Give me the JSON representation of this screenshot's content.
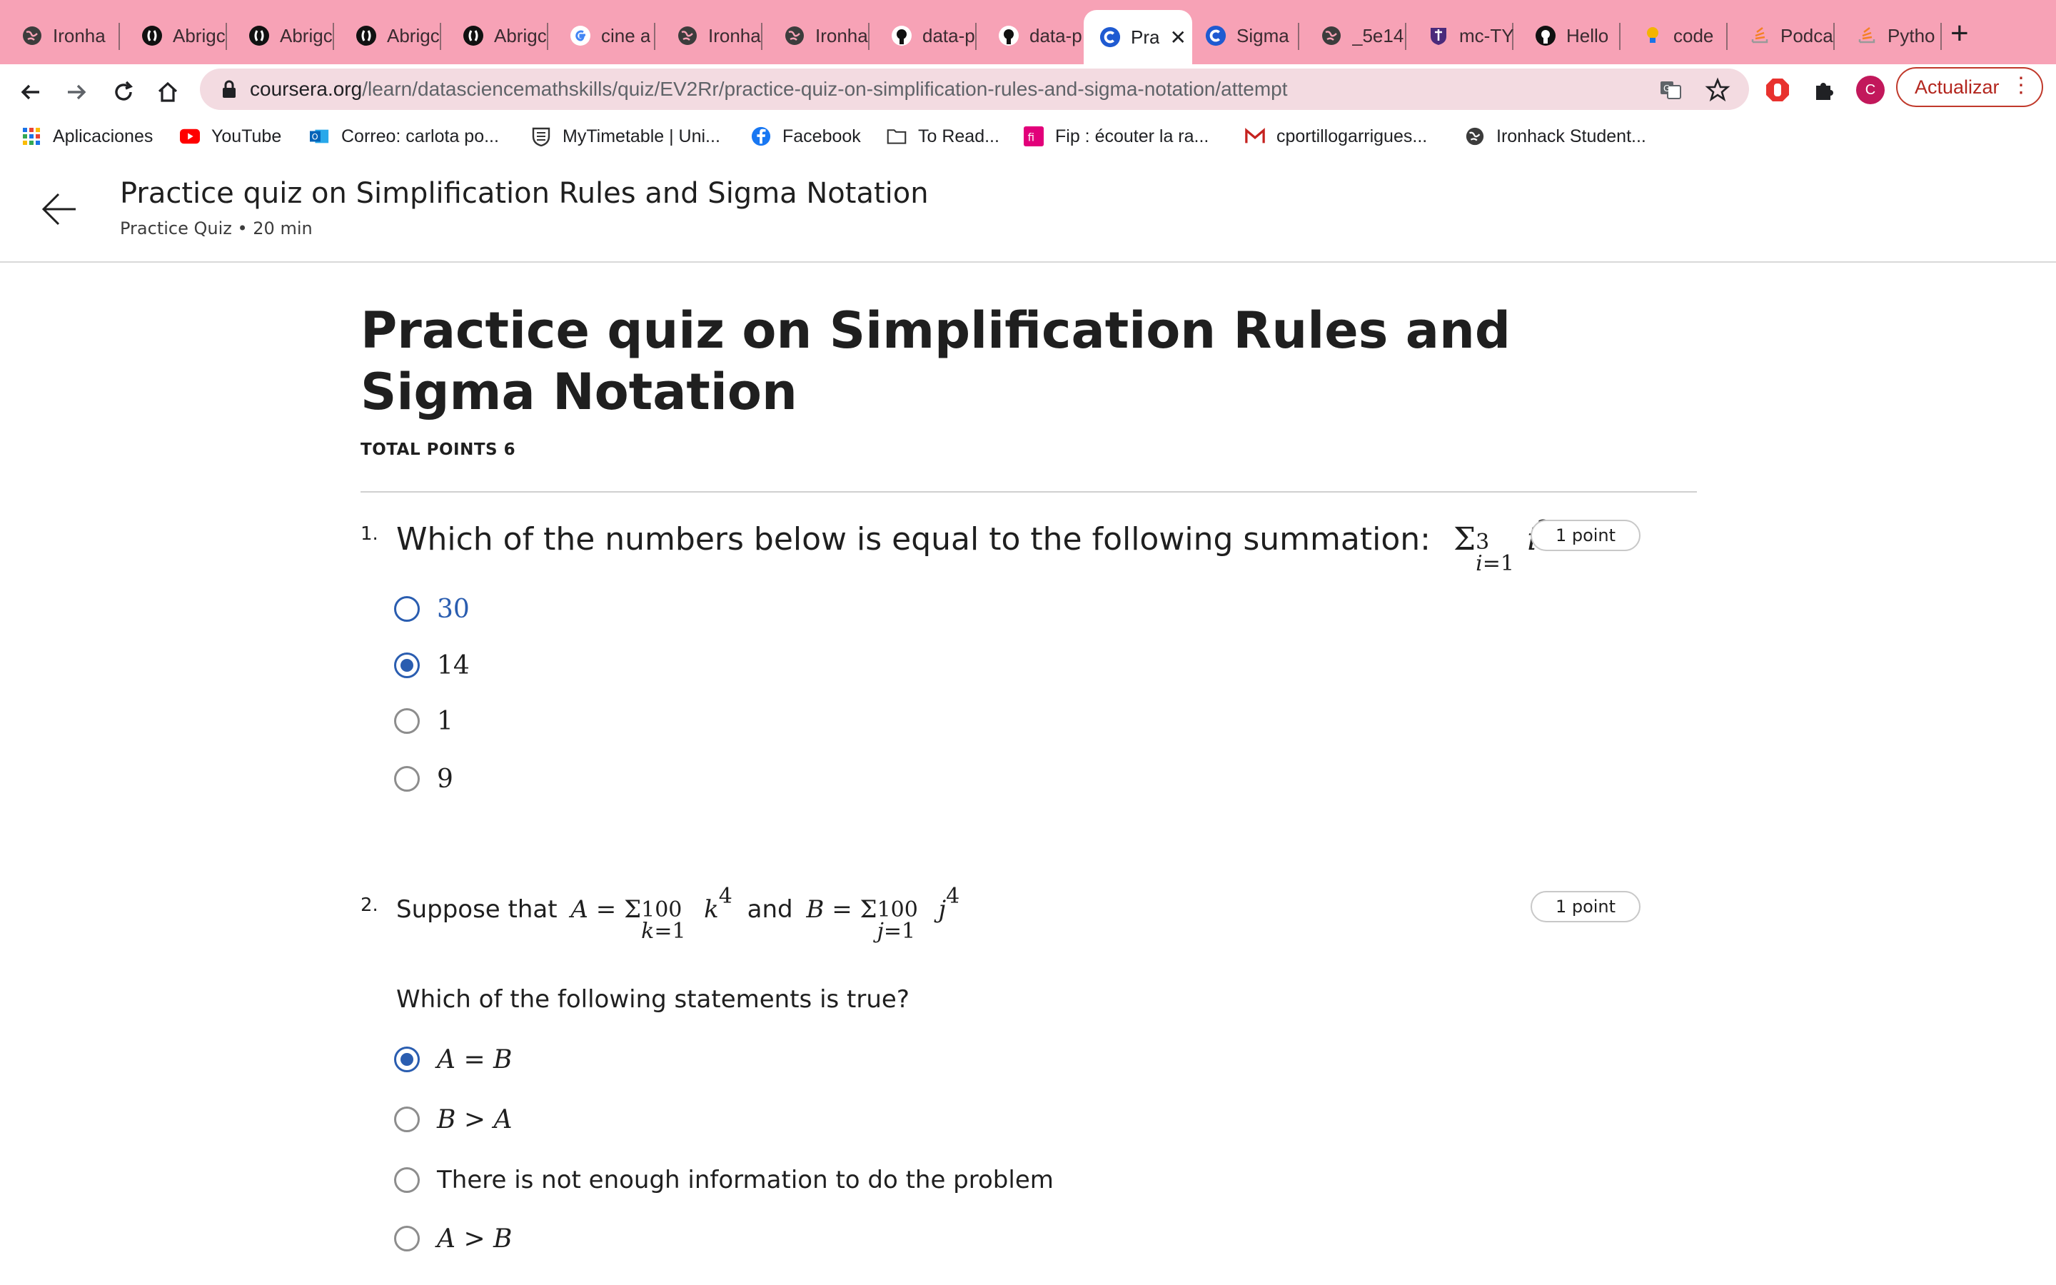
{
  "browser": {
    "tabs": [
      {
        "label": "Ironha",
        "icon": "globe-icon"
      },
      {
        "label": "Abrigc",
        "icon": "codepen-icon"
      },
      {
        "label": "Abrigc",
        "icon": "codepen-icon"
      },
      {
        "label": "Abrigc",
        "icon": "codepen-icon"
      },
      {
        "label": "Abrigc",
        "icon": "codepen-icon"
      },
      {
        "label": "cine a",
        "icon": "google-icon"
      },
      {
        "label": "Ironha",
        "icon": "globe-icon"
      },
      {
        "label": "Ironha",
        "icon": "globe-icon"
      },
      {
        "label": "data-p",
        "icon": "github-icon"
      },
      {
        "label": "data-p",
        "icon": "github-icon"
      },
      {
        "label": "Pra",
        "icon": "coursera-icon",
        "active": true
      },
      {
        "label": "Sigma",
        "icon": "coursera-icon"
      },
      {
        "label": "_5e14",
        "icon": "globe-icon"
      },
      {
        "label": "mc-TY",
        "icon": "shield-crest-icon"
      },
      {
        "label": "Hello",
        "icon": "github-icon"
      },
      {
        "label": "code",
        "icon": "lightbulb-icon"
      },
      {
        "label": "Podca",
        "icon": "stack-icon"
      },
      {
        "label": "Pytho",
        "icon": "stack-icon"
      }
    ],
    "url_host": "coursera.org",
    "url_path": "/learn/datasciencemathskills/quiz/EV2Rr/practice-quiz-on-simplification-rules-and-sigma-notation/attempt",
    "update_label": "Actualizar",
    "profile_letter": "C",
    "accent": "#f7a2b6",
    "bookmarks": [
      {
        "label": "Aplicaciones",
        "icon": "apps-grid-icon"
      },
      {
        "label": "YouTube",
        "icon": "youtube-icon"
      },
      {
        "label": "Correo: carlota po...",
        "icon": "outlook-icon"
      },
      {
        "label": "MyTimetable | Uni...",
        "icon": "crest-icon"
      },
      {
        "label": "Facebook",
        "icon": "facebook-icon"
      },
      {
        "label": "To Read...",
        "icon": "folder-icon"
      },
      {
        "label": "Fip : écouter la ra...",
        "icon": "fip-icon"
      },
      {
        "label": "cportillogarrigues...",
        "icon": "gmail-icon"
      },
      {
        "label": "Ironhack Student...",
        "icon": "globe-icon"
      }
    ]
  },
  "header": {
    "title": "Practice quiz on Simplification Rules and Sigma Notation",
    "subtitle": "Practice Quiz • 20 min"
  },
  "quiz": {
    "title": "Practice quiz on Simplification Rules and Sigma Notation",
    "total_points": "TOTAL POINTS 6",
    "questions": [
      {
        "number": "1.",
        "text": "Which of the numbers below is equal to the following summation:",
        "points": "1 point",
        "options": [
          "30",
          "14",
          "1",
          "9"
        ],
        "selected": 1
      },
      {
        "number": "2.",
        "text_prefix": "Suppose that",
        "text_and": "and",
        "prompt": "Which of the following statements is true?",
        "points": "1 point",
        "options": [
          "A = B",
          "B > A",
          "There is not enough information to do the problem",
          "A > B"
        ],
        "selected": 0
      }
    ]
  }
}
